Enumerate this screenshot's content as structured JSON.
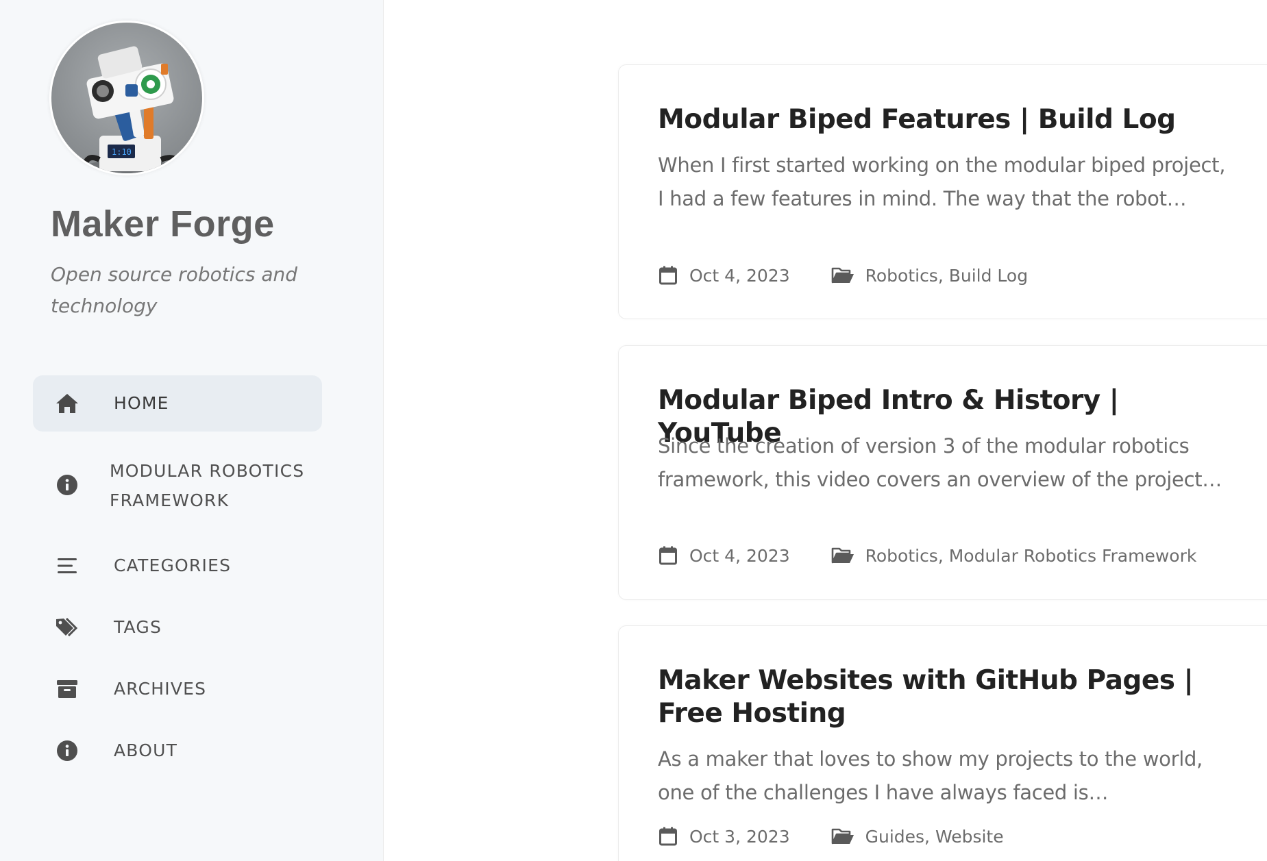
{
  "site": {
    "title": "Maker Forge",
    "subtitle": "Open source robotics and technology"
  },
  "nav": {
    "items": [
      {
        "label": "HOME",
        "icon": "home-icon",
        "active": true
      },
      {
        "label": "MODULAR ROBOTICS FRAMEWORK",
        "icon": "info-circle-icon",
        "active": false
      },
      {
        "label": "CATEGORIES",
        "icon": "stream-icon",
        "active": false
      },
      {
        "label": "TAGS",
        "icon": "tags-icon",
        "active": false
      },
      {
        "label": "ARCHIVES",
        "icon": "archive-icon",
        "active": false
      },
      {
        "label": "ABOUT",
        "icon": "info-circle-icon",
        "active": false
      }
    ]
  },
  "posts": [
    {
      "title": "Modular Biped Features | Build Log",
      "excerpt": "When I first started working on the modular biped project, I had a few features in mind. The way that the robot behaves and looks",
      "date": "Oct 4, 2023",
      "categories": "Robotics, Build Log"
    },
    {
      "title": "Modular Biped Intro & History | YouTube",
      "excerpt": "Since the creation of version 3 of the modular robotics framework, this video covers an overview of the project and its history",
      "date": "Oct 4, 2023",
      "categories": "Robotics, Modular Robotics Framework"
    },
    {
      "title": "Maker Websites with GitHub Pages | Free Hosting",
      "excerpt": "As a maker that loves to show my projects to the world, one of the challenges I have always faced is understanding the options",
      "date": "Oct 3, 2023",
      "categories": "Guides, Website"
    }
  ],
  "colors": {
    "sidebar_bg": "#f6f8fa",
    "active_nav_bg": "#e8edf2",
    "title_text": "#222222",
    "muted_text": "#6c6c6c"
  }
}
